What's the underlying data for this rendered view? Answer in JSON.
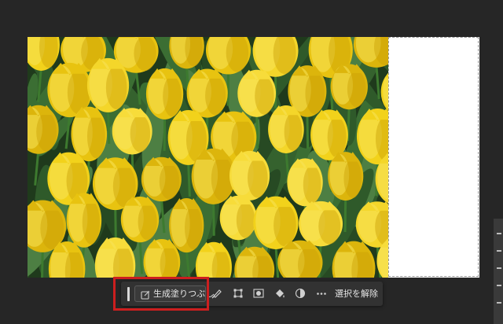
{
  "canvas": {
    "background_color": "#262626",
    "image_description": "",
    "extended_area_color": "#ffffff"
  },
  "contextual_taskbar": {
    "generative_fill_label": "生成塗りつぶし",
    "generative_fill_icon": "generative-fill-icon",
    "tools": [
      {
        "icon": "brush-select-icon"
      },
      {
        "icon": "transform-selection-icon"
      },
      {
        "icon": "mask-icon"
      },
      {
        "icon": "fill-bucket-icon"
      },
      {
        "icon": "invert-icon"
      },
      {
        "icon": "more-icon"
      }
    ],
    "deselect_label": "選択を解除"
  },
  "annotation": {
    "highlight_color": "#cc1f1f"
  }
}
